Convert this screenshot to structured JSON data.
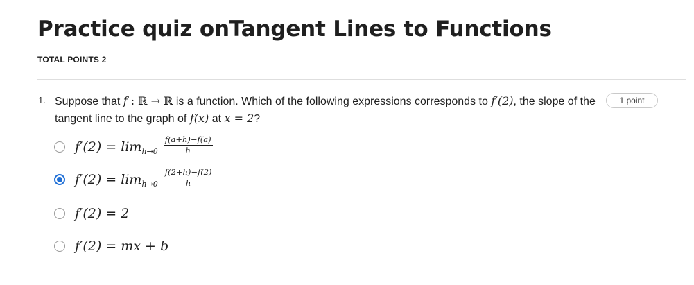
{
  "quiz": {
    "title": "Practice quiz onTangent Lines to Functions",
    "total_points": "TOTAL POINTS 2"
  },
  "question": {
    "number": "1.",
    "text_parts": {
      "p1": "Suppose that ",
      "f": "f",
      "colon": " : ",
      "R1": "ℝ",
      "arrow": " → ",
      "R2": "ℝ",
      "p2": " is a function. Which of the following expressions corresponds to ",
      "fprime2": "f′(2)",
      "p3": ", the slope of the tangent line to the graph of ",
      "fx": "f(x)",
      "p4": " at ",
      "xeq": "x = 2",
      "p5": "?"
    },
    "points_badge": "1 point",
    "options": [
      {
        "lhs": "f′(2) = lim",
        "sub": "h→0",
        "numerator": "f(a+h)−f(a)",
        "denominator": "h",
        "selected": false
      },
      {
        "lhs": "f′(2) = lim",
        "sub": "h→0",
        "numerator": "f(2+h)−f(2)",
        "denominator": "h",
        "selected": true
      },
      {
        "lhs": "f′(2) = 2",
        "selected": false
      },
      {
        "lhs": "f′(2) = mx + b",
        "selected": false
      }
    ]
  },
  "colors": {
    "accent": "#1f6fd6",
    "text": "#1f1f1f",
    "divider": "#dedede"
  }
}
